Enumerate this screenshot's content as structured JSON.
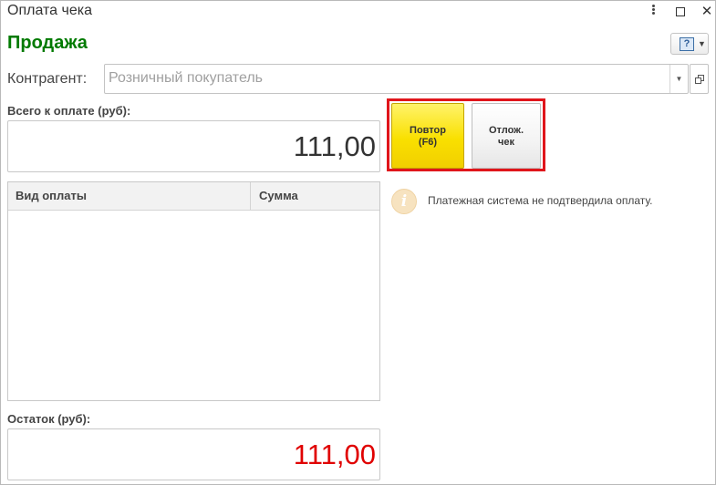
{
  "window": {
    "title": "Оплата чека"
  },
  "form": {
    "header": "Продажа"
  },
  "kontragent": {
    "label": "Контрагент:",
    "value": "Розничный покупатель"
  },
  "total": {
    "label": "Всего к оплате (руб):",
    "value": "111,00"
  },
  "payments_table": {
    "columns": [
      "Вид оплаты",
      "Сумма"
    ],
    "rows": []
  },
  "remainder": {
    "label": "Остаток (руб):",
    "value": "111,00"
  },
  "buttons": {
    "retry_line1": "Повтор",
    "retry_line2": "(F6)",
    "defer_line1": "Отлож.",
    "defer_line2": "чек"
  },
  "message": {
    "text": "Платежная система не подтвердила оплату."
  },
  "colors": {
    "header_green": "#007a00",
    "retry_yellow": "#f9e000",
    "remainder_red": "#e00000",
    "highlight_red": "#e0151b"
  },
  "icons": {
    "help": "help-icon",
    "info": "info-icon",
    "menu": "more-vertical-icon",
    "maximize": "maximize-icon",
    "close": "close-icon",
    "dropdown": "chevron-down-icon",
    "open": "open-in-window-icon"
  }
}
